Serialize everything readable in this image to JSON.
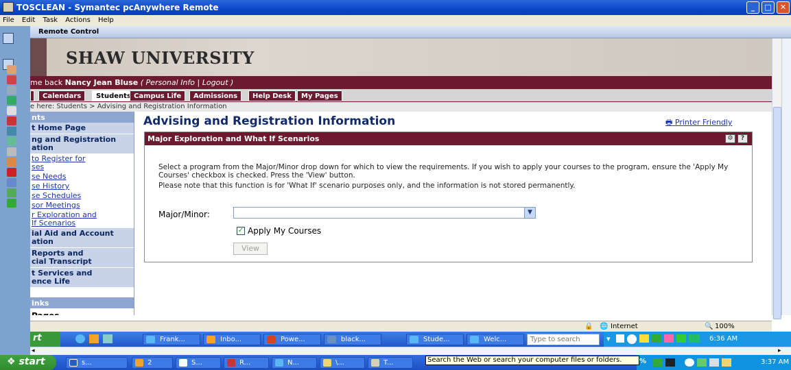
{
  "window": {
    "title": "TOSCLEAN - Symantec pcAnywhere Remote",
    "controls": [
      "minimize",
      "maximize",
      "close"
    ]
  },
  "menu": [
    "File",
    "Edit",
    "Task",
    "Actions",
    "Help"
  ],
  "remote_control_label": "Remote Control",
  "site": {
    "name": "SHAW UNIVERSITY",
    "welcome_prefix": "me back ",
    "user_name": "Nancy Jean Bluse",
    "personal_info": "( Personal Info | Logout )",
    "tabs": [
      "Calendars",
      "Students",
      "Campus Life",
      "Admissions",
      "Help Desk",
      "My Pages"
    ],
    "active_tab": "Students",
    "breadcrumb": "e here:  Students > Advising and Registration Information"
  },
  "sidebar": {
    "header": "nts",
    "items": [
      {
        "label": "t Home Page",
        "type": "group"
      },
      {
        "label": "ng and Registration\nation",
        "type": "group"
      },
      {
        "label": "to Register for\nses",
        "type": "link"
      },
      {
        "label": "se Needs",
        "type": "link"
      },
      {
        "label": "se History",
        "type": "link"
      },
      {
        "label": "se Schedules",
        "type": "link"
      },
      {
        "label": "sor Meetings",
        "type": "link"
      },
      {
        "label": "r Exploration and\nIf Scenarios",
        "type": "link"
      },
      {
        "label": "ial Aid and Account\nation",
        "type": "group"
      },
      {
        "label": "Reports and\ncial Transcript",
        "type": "group"
      },
      {
        "label": "t Services and\nence Life",
        "type": "group"
      }
    ],
    "links_header": "inks",
    "pages": "Pages"
  },
  "main": {
    "title": "Advising and Registration Information",
    "printer_friendly": "Printer Friendly",
    "panel_title": "Major Exploration and What If Scenarios",
    "instructions1": "Select a program from the Major/Minor drop down for which to view the requirements. If you wish to apply your courses to the program, ensure the 'Apply My Courses' checkbox is checked. Press the 'View' button.",
    "instructions2": "Please note that this function is for 'What If' scenario purposes only, and the information is not stored permanently.",
    "major_label": "Major/Minor:",
    "major_value": "",
    "apply_label": "Apply My Courses",
    "apply_checked": true,
    "view_button": "View"
  },
  "statusbar": {
    "zone": "Internet",
    "zoom": "100%"
  },
  "inner_taskbar": {
    "start": "rt",
    "tasks": [
      "Frank...",
      "Inbo...",
      "Powe...",
      "black...",
      "Stude...",
      "Welc..."
    ],
    "search_placeholder": "Type to search",
    "clock": "6:36 AM"
  },
  "outer_taskbar": {
    "start": "start",
    "tasks": [
      "s...",
      "2",
      "S...",
      "R...",
      "N...",
      "\\...",
      "T..."
    ],
    "tooltip": "Search the Web or search your computer files or folders.",
    "zoom_partial": "% ",
    "clock": "3:37 AM"
  }
}
